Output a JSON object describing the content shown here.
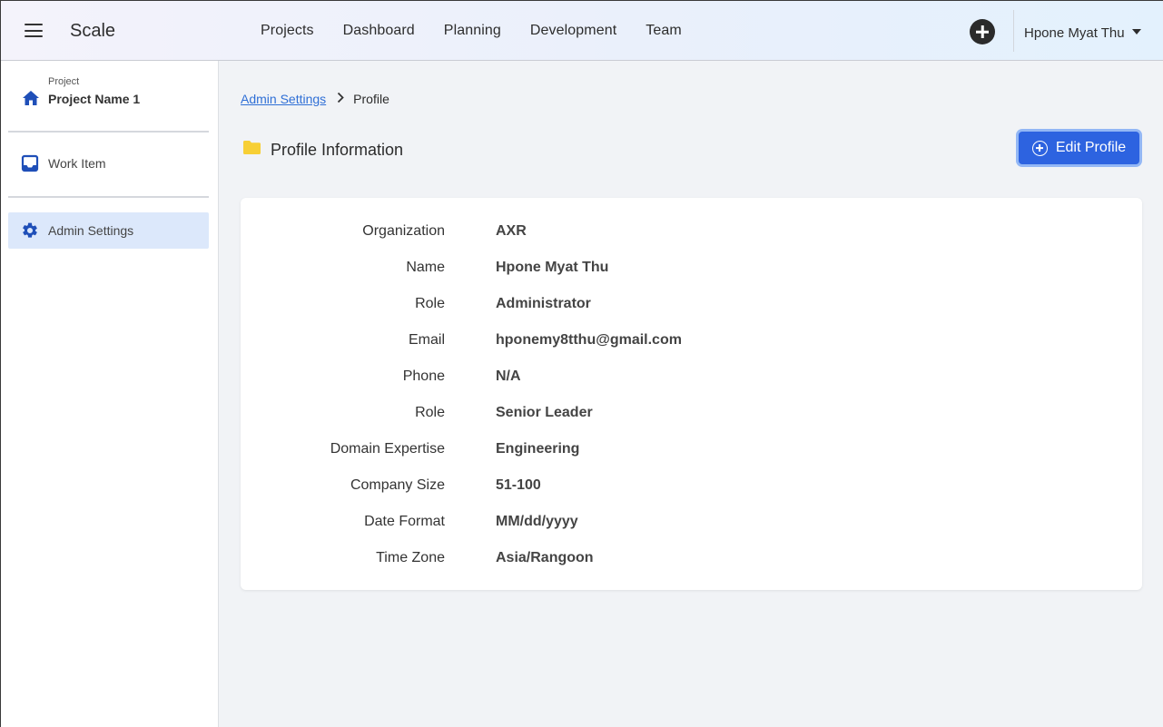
{
  "app": {
    "brand": "Scale"
  },
  "nav": {
    "items": [
      "Projects",
      "Dashboard",
      "Planning",
      "Development",
      "Team"
    ]
  },
  "user": {
    "name": "Hpone Myat Thu"
  },
  "sidebar": {
    "project_label": "Project",
    "project_name": "Project Name 1",
    "items": [
      {
        "label": "Work Item",
        "icon": "inbox-icon",
        "active": false
      },
      {
        "label": "Admin Settings",
        "icon": "gear-icon",
        "active": true
      }
    ]
  },
  "breadcrumb": {
    "parent": "Admin Settings",
    "current": "Profile"
  },
  "section": {
    "title": "Profile Information",
    "icon": "folder-icon",
    "icon_color": "#f7cf35"
  },
  "edit_button": {
    "label": "Edit Profile"
  },
  "profile": {
    "fields": [
      {
        "label": "Organization",
        "value": "AXR"
      },
      {
        "label": "Name",
        "value": "Hpone Myat Thu"
      },
      {
        "label": "Role",
        "value": "Administrator"
      },
      {
        "label": "Email",
        "value": "hponemy8tthu@gmail.com"
      },
      {
        "label": "Phone",
        "value": "N/A"
      },
      {
        "label": "Role",
        "value": "Senior Leader"
      },
      {
        "label": "Domain Expertise",
        "value": "Engineering"
      },
      {
        "label": "Company Size",
        "value": "51-100"
      },
      {
        "label": "Date Format",
        "value": "MM/dd/yyyy"
      },
      {
        "label": "Time Zone",
        "value": "Asia/Rangoon"
      }
    ]
  },
  "colors": {
    "accent": "#2d63e0",
    "link": "#2f6fd6",
    "active_bg": "#dce8fb",
    "icon_blue": "#1f4fb8"
  }
}
